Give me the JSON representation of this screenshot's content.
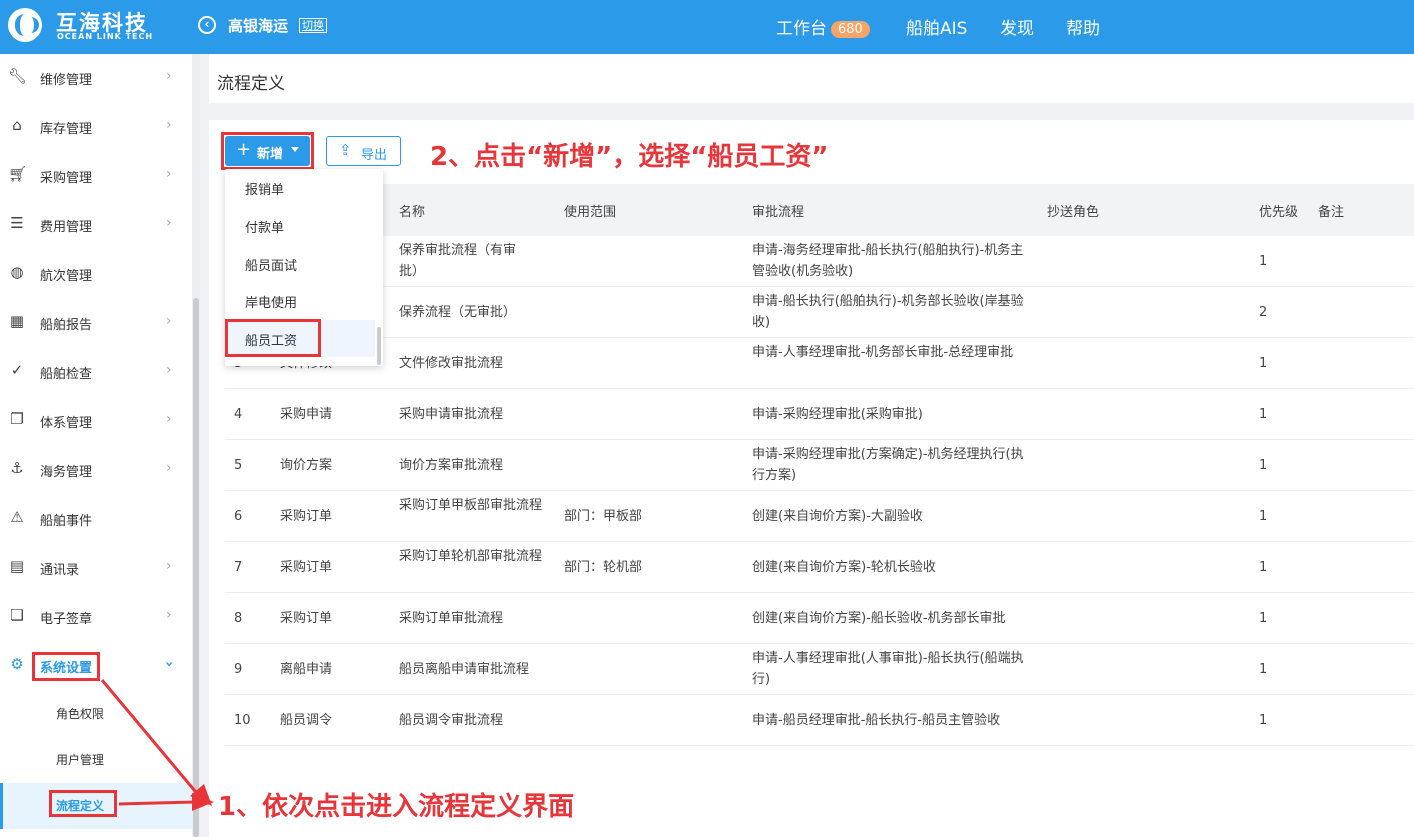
{
  "header": {
    "logo_cn": "互海科技",
    "logo_en": "OCEAN LINK TECH",
    "company": "高银海运",
    "switch_label": "切换",
    "nav": [
      {
        "label": "工作台",
        "badge": "680"
      },
      {
        "label": "船舶AIS"
      },
      {
        "label": "发现"
      },
      {
        "label": "帮助"
      }
    ]
  },
  "sidebar": {
    "items": [
      {
        "label": "维修管理",
        "icon": "wrench-icon"
      },
      {
        "label": "库存管理",
        "icon": "home-icon"
      },
      {
        "label": "采购管理",
        "icon": "cart-icon"
      },
      {
        "label": "费用管理",
        "icon": "database-icon"
      },
      {
        "label": "航次管理",
        "icon": "globe-icon"
      },
      {
        "label": "船舶报告",
        "icon": "calendar-icon"
      },
      {
        "label": "船舶检查",
        "icon": "check-circle-icon"
      },
      {
        "label": "体系管理",
        "icon": "document-icon"
      },
      {
        "label": "海务管理",
        "icon": "anchor-icon"
      },
      {
        "label": "船舶事件",
        "icon": "warning-icon"
      },
      {
        "label": "通讯录",
        "icon": "server-icon"
      },
      {
        "label": "电子签章",
        "icon": "stamp-icon"
      },
      {
        "label": "系统设置",
        "icon": "gear-icon"
      }
    ],
    "sub_items": [
      {
        "label": "角色权限"
      },
      {
        "label": "用户管理"
      },
      {
        "label": "流程定义"
      }
    ]
  },
  "page": {
    "title": "流程定义",
    "add_button": "新增",
    "export_button": "导出"
  },
  "dropdown": {
    "items": [
      "报销单",
      "付款单",
      "船员面试",
      "岸电使用",
      "船员工资"
    ]
  },
  "table": {
    "headers": [
      "名称",
      "使用范围",
      "审批流程",
      "抄送角色",
      "优先级",
      "备注"
    ],
    "rows": [
      {
        "no": "",
        "type": "",
        "name": "保养审批流程（有审批）",
        "scope": "",
        "flow": "申请-海务经理审批-船长执行(船舶执行)-机务主管验收(机务验收)",
        "priority": "1"
      },
      {
        "no": "",
        "type": "",
        "name": "保养流程（无审批）",
        "scope": "",
        "flow": "申请-船长执行(船舶执行)-机务部长验收(岸基验收)",
        "priority": "2"
      },
      {
        "no": "3",
        "type": "文件修改",
        "name": "文件修改审批流程",
        "scope": "",
        "flow": "申请-人事经理审批-机务部长审批-总经理审批",
        "priority": "1"
      },
      {
        "no": "4",
        "type": "采购申请",
        "name": "采购申请审批流程",
        "scope": "",
        "flow": "申请-采购经理审批(采购审批)",
        "priority": "1"
      },
      {
        "no": "5",
        "type": "询价方案",
        "name": "询价方案审批流程",
        "scope": "",
        "flow": "申请-采购经理审批(方案确定)-机务经理执行(执行方案)",
        "priority": "1"
      },
      {
        "no": "6",
        "type": "采购订单",
        "name": "采购订单甲板部审批流程",
        "scope": "部门：甲板部",
        "flow": "创建(来自询价方案)-大副验收",
        "priority": "1"
      },
      {
        "no": "7",
        "type": "采购订单",
        "name": "采购订单轮机部审批流程",
        "scope": "部门：轮机部",
        "flow": "创建(来自询价方案)-轮机长验收",
        "priority": "1"
      },
      {
        "no": "8",
        "type": "采购订单",
        "name": "采购订单审批流程",
        "scope": "",
        "flow": "创建(来自询价方案)-船长验收-机务部长审批",
        "priority": "1"
      },
      {
        "no": "9",
        "type": "离船申请",
        "name": "船员离船申请审批流程",
        "scope": "",
        "flow": "申请-人事经理审批(人事审批)-船长执行(船端执行)",
        "priority": "1"
      },
      {
        "no": "10",
        "type": "船员调令",
        "name": "船员调令审批流程",
        "scope": "",
        "flow": "申请-船员经理审批-船长执行-船员主管验收",
        "priority": "1"
      }
    ]
  },
  "annotations": {
    "step2": "2、点击“新增”，选择“船员工资”",
    "step1": "1、依次点击进入流程定义界面"
  },
  "colors": {
    "primary": "#2b9ae8",
    "annotation": "#e8353a",
    "badge": "#f5a467"
  }
}
